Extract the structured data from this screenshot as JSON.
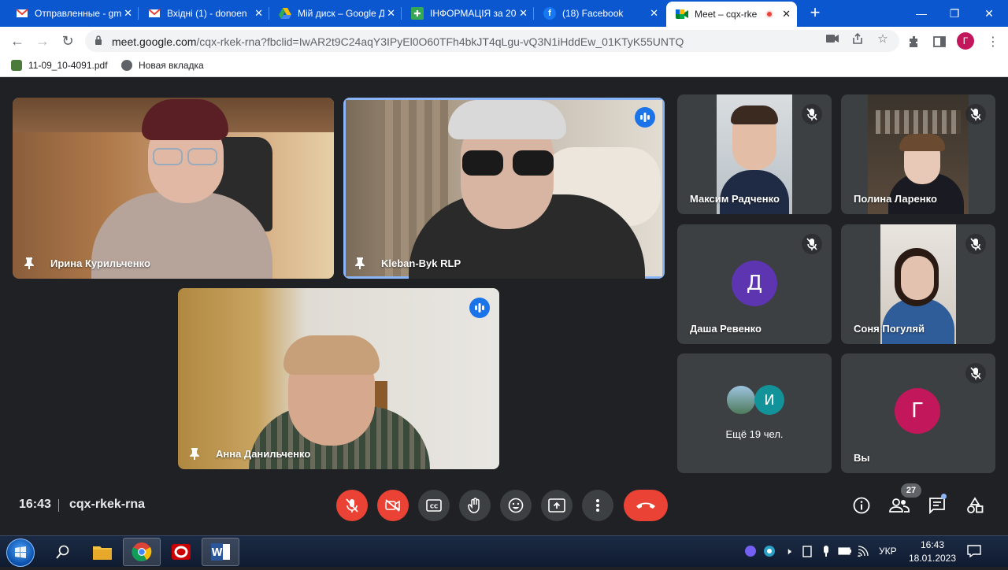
{
  "browser": {
    "tabs": [
      {
        "title": "Отправленные - gm",
        "icon": "gmail-icon",
        "active": false
      },
      {
        "title": "Вхідні (1) - donoen",
        "icon": "gmail-icon",
        "active": false
      },
      {
        "title": "Мій диск – Google Д",
        "icon": "google-drive-icon",
        "active": false
      },
      {
        "title": "ІНФОРМАЦІЯ за 20",
        "icon": "cross-icon",
        "active": false
      },
      {
        "title": "(18) Facebook",
        "icon": "facebook-icon",
        "active": false
      },
      {
        "title": "Meet – cqx-rke",
        "icon": "google-meet-icon",
        "active": true
      }
    ],
    "url_host": "meet.google.com",
    "url_path": "/cqx-rkek-rna?fbclid=IwAR2t9C24aqY3IPyEl0O60TFh4bkJT4qLgu-vQ3N1iHddEw_01KTyK55UNTQ",
    "profile_initial": "Г",
    "bookmarks": [
      {
        "label": "11-09_10-4091.pdf",
        "icon": "pdf-icon"
      },
      {
        "label": "Новая вкладка",
        "icon": "globe-icon"
      }
    ],
    "colors": {
      "tab_strip": "#0b57d0"
    }
  },
  "meet": {
    "participants_main": [
      {
        "name": "Ирина Курильченко",
        "pinned": true,
        "speaking": false
      },
      {
        "name": "Kleban-Byk RLP",
        "pinned": true,
        "speaking": true
      },
      {
        "name": "Анна Данильченко",
        "pinned": true,
        "speaking": true
      }
    ],
    "participants_side": [
      {
        "name": "Максим Радченко",
        "muted": true,
        "video": true
      },
      {
        "name": "Полина Ларенко",
        "muted": true,
        "video": true
      },
      {
        "name": "Даша Ревенко",
        "muted": true,
        "video": false,
        "avatar_letter": "Д",
        "avatar_color": "#5e35b1"
      },
      {
        "name": "Соня Погуляй",
        "muted": true,
        "video": true
      },
      {
        "name": "Вы",
        "muted": true,
        "video": false,
        "avatar_letter": "Г",
        "avatar_color": "#c2185b"
      }
    ],
    "others": {
      "label": "Ещё 19 чел.",
      "avatar_letter": "И",
      "avatar_color": "#12939a"
    },
    "time": "16:43",
    "meeting_code": "cqx-rkek-rna",
    "participant_count": "27"
  },
  "taskbar": {
    "language": "УКР",
    "time": "16:43",
    "date": "18.01.2023"
  }
}
